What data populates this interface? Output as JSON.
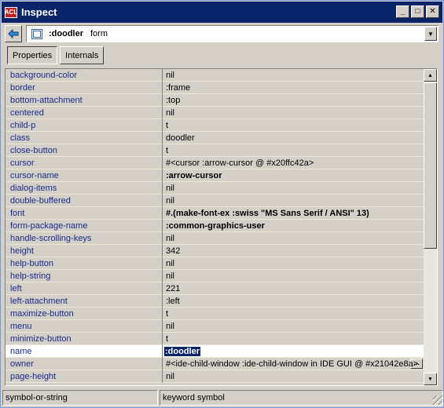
{
  "window": {
    "title": "Inspect",
    "icon_text": "ACL",
    "buttons": {
      "minimize": "_",
      "maximize": "□",
      "close": "✕"
    }
  },
  "toolbar": {
    "back_icon": "back-arrow-icon",
    "object_name": ":doodler",
    "object_type": "form",
    "dropdown_icon": "▼"
  },
  "tabs": [
    {
      "label": "Properties",
      "active": true
    },
    {
      "label": "Internals",
      "active": false
    }
  ],
  "properties": [
    {
      "name": "background-color",
      "value": "nil",
      "bold": false
    },
    {
      "name": "border",
      "value": ":frame",
      "bold": false
    },
    {
      "name": "bottom-attachment",
      "value": ":top",
      "bold": false
    },
    {
      "name": "centered",
      "value": "nil",
      "bold": false
    },
    {
      "name": "child-p",
      "value": "t",
      "bold": false
    },
    {
      "name": "class",
      "value": "doodler",
      "bold": false
    },
    {
      "name": "close-button",
      "value": "t",
      "bold": false
    },
    {
      "name": "cursor",
      "value": "#<cursor :arrow-cursor @ #x20ffc42a>",
      "bold": false
    },
    {
      "name": "cursor-name",
      "value": ":arrow-cursor",
      "bold": true
    },
    {
      "name": "dialog-items",
      "value": "nil",
      "bold": false
    },
    {
      "name": "double-buffered",
      "value": "nil",
      "bold": false
    },
    {
      "name": "font",
      "value": "#.(make-font-ex :swiss \"MS Sans Serif / ANSI\" 13)",
      "bold": true
    },
    {
      "name": "form-package-name",
      "value": ":common-graphics-user",
      "bold": true
    },
    {
      "name": "handle-scrolling-keys",
      "value": "nil",
      "bold": false
    },
    {
      "name": "height",
      "value": "342",
      "bold": false
    },
    {
      "name": "help-button",
      "value": "nil",
      "bold": false
    },
    {
      "name": "help-string",
      "value": "nil",
      "bold": false
    },
    {
      "name": "left",
      "value": "221",
      "bold": false
    },
    {
      "name": "left-attachment",
      "value": ":left",
      "bold": false
    },
    {
      "name": "maximize-button",
      "value": "t",
      "bold": false
    },
    {
      "name": "menu",
      "value": "nil",
      "bold": false
    },
    {
      "name": "minimize-button",
      "value": "t",
      "bold": false
    },
    {
      "name": "name",
      "value": ":doodler",
      "bold": true,
      "selected": true
    },
    {
      "name": "owner",
      "value": "#<ide-child-window :ide-child-window in IDE GUI @ #x21042e8a>",
      "bold": false
    },
    {
      "name": "page-height",
      "value": "nil",
      "bold": false
    }
  ],
  "editor": {
    "ellipsis_label": "..."
  },
  "status": {
    "left": "symbol-or-string",
    "right": "keyword symbol"
  }
}
